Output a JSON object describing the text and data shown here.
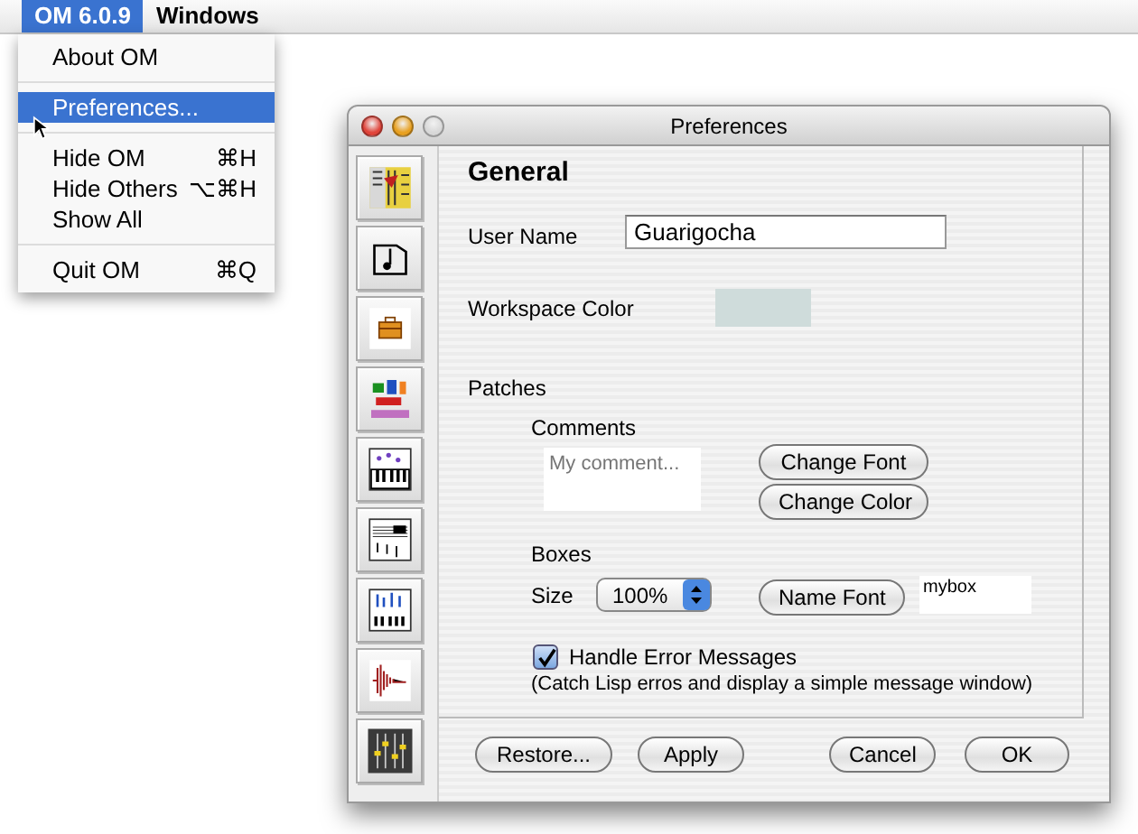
{
  "menubar": {
    "items": [
      {
        "label": "OM 6.0.9",
        "selected": true
      },
      {
        "label": "Windows",
        "selected": false
      }
    ]
  },
  "menu": {
    "items": [
      {
        "kind": "item",
        "label": "About OM",
        "selected": false
      },
      {
        "kind": "separator"
      },
      {
        "kind": "item",
        "label": "Preferences...",
        "selected": true
      },
      {
        "kind": "separator"
      },
      {
        "kind": "item",
        "label": "Hide OM",
        "shortcut": "⌘H",
        "selected": false
      },
      {
        "kind": "item",
        "label": "Hide Others",
        "shortcut": "⌥⌘H",
        "selected": false
      },
      {
        "kind": "item",
        "label": "Show All",
        "selected": false
      },
      {
        "kind": "separator"
      },
      {
        "kind": "item",
        "label": "Quit OM",
        "shortcut": "⌘Q",
        "selected": false
      }
    ]
  },
  "window": {
    "title": "Preferences",
    "section_title": "General",
    "user_name": {
      "label": "User Name",
      "value": "Guarigocha"
    },
    "workspace_color": {
      "label": "Workspace Color",
      "color": "#cfdcdb"
    },
    "patches": {
      "label": "Patches",
      "comments": {
        "label": "Comments",
        "placeholder": "My comment...",
        "buttons": [
          "Change Font",
          "Change Color"
        ]
      },
      "boxes": {
        "label": "Boxes",
        "size_label": "Size",
        "size_value": "100%",
        "button": "Name Font",
        "name_value": "mybox"
      }
    },
    "handle_errors": {
      "label": "Handle Error Messages",
      "checked": true,
      "note": "(Catch Lisp erros and display a simple message window)"
    },
    "buttons": [
      "Restore...",
      "Apply",
      "Cancel",
      "OK"
    ]
  }
}
